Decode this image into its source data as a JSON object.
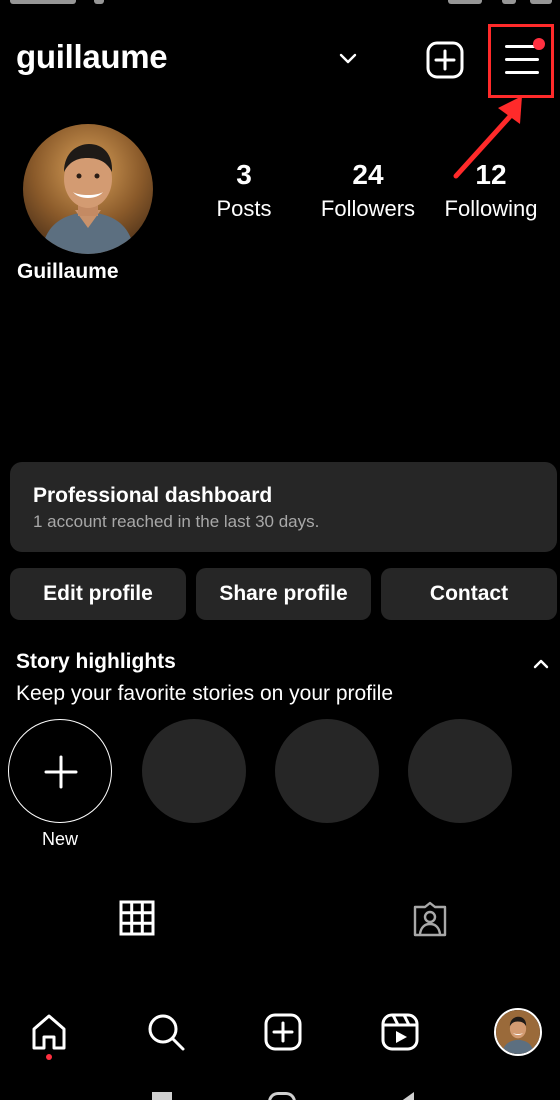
{
  "header": {
    "username": "guillaume"
  },
  "profile": {
    "display_name": "Guillaume",
    "stats": [
      {
        "value": "3",
        "label": "Posts"
      },
      {
        "value": "24",
        "label": "Followers"
      },
      {
        "value": "12",
        "label": "Following"
      }
    ]
  },
  "dashboard": {
    "title": "Professional dashboard",
    "subtitle": "1 account reached in the last 30 days."
  },
  "actions": {
    "edit": "Edit profile",
    "share": "Share profile",
    "contact": "Contact"
  },
  "highlights": {
    "title": "Story highlights",
    "subtitle": "Keep your favorite stories on your profile",
    "new_label": "New"
  },
  "colors": {
    "background": "#000000",
    "surface": "#262626",
    "annotation": "#ff2a2a",
    "notification": "#ff3040"
  },
  "icons": {
    "dropdown": "chevron-down-icon",
    "create": "plus-square-icon",
    "menu": "hamburger-icon",
    "grid": "grid-icon",
    "tagged": "tagged-person-icon",
    "nav": [
      "home-icon",
      "search-icon",
      "create-icon",
      "reels-icon",
      "profile-avatar"
    ]
  }
}
